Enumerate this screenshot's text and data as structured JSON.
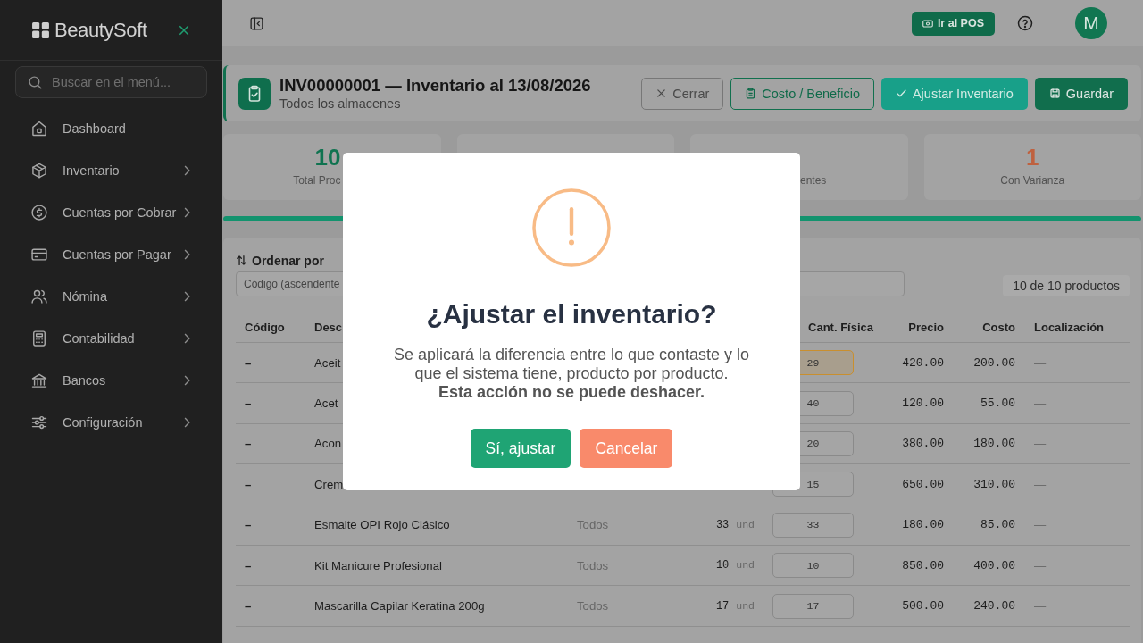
{
  "sidebar": {
    "brand": "BeautySoft",
    "search": {
      "placeholder": "Buscar en el menú..."
    },
    "items": [
      {
        "label": "Dashboard",
        "expandable": false
      },
      {
        "label": "Inventario",
        "expandable": true
      },
      {
        "label": "Cuentas por Cobrar",
        "expandable": true
      },
      {
        "label": "Cuentas por Pagar",
        "expandable": true
      },
      {
        "label": "Nómina",
        "expandable": true
      },
      {
        "label": "Contabilidad",
        "expandable": true
      },
      {
        "label": "Bancos",
        "expandable": true
      },
      {
        "label": "Configuración",
        "expandable": true
      }
    ]
  },
  "topbar": {
    "pos_button": "Ir al POS",
    "avatar": "M"
  },
  "document": {
    "title": "INV00000001 — Inventario al 13/08/2026",
    "subtitle": "Todos los almacenes",
    "actions": [
      {
        "label": "Cerrar",
        "kind": "close"
      },
      {
        "label": "Costo / Beneficio",
        "kind": "report"
      },
      {
        "label": "Ajustar Inventario",
        "kind": "adjust"
      },
      {
        "label": "Guardar",
        "kind": "save"
      }
    ]
  },
  "stats": [
    {
      "value": "10",
      "label": "Total Proc",
      "color": "#0f7350"
    },
    {
      "label": "entes"
    },
    {
      "value": "1",
      "label": "Con Varianza",
      "color": "#bf613f"
    }
  ],
  "progress": {
    "level": 1
  },
  "products": {
    "sort_label": "Ordenar por",
    "sort_value": "Código (ascendente",
    "count": "10 de 10 productos",
    "columns": {
      "code": "Código",
      "description": "Desc",
      "physical_qty": "Cant. Física",
      "price": "Precio",
      "cost": "Costo",
      "location": "Localización"
    },
    "rows": [
      {
        "code": "–",
        "description": "Aceit",
        "physical_qty": "29",
        "price": "420.00",
        "cost": "200.00",
        "location": "—",
        "has_variance": true
      },
      {
        "code": "–",
        "description": "Acet",
        "physical_qty": "40",
        "price": "120.00",
        "cost": "55.00",
        "location": "—",
        "has_variance": false
      },
      {
        "code": "–",
        "description": "Acon",
        "physical_qty": "20",
        "price": "380.00",
        "cost": "180.00",
        "location": "—",
        "has_variance": false
      },
      {
        "code": "–",
        "description": "Crem",
        "physical_qty": "15",
        "price": "650.00",
        "cost": "310.00",
        "location": "—",
        "has_variance": false
      },
      {
        "code": "–",
        "description": "Esmalte OPI Rojo Clásico",
        "warehouse": "Todos",
        "system_qty": "33",
        "unit": "und",
        "physical_qty": "33",
        "price": "180.00",
        "cost": "85.00",
        "location": "—",
        "has_variance": false
      },
      {
        "code": "–",
        "description": "Kit Manicure Profesional",
        "warehouse": "Todos",
        "system_qty": "10",
        "unit": "und",
        "physical_qty": "10",
        "price": "850.00",
        "cost": "400.00",
        "location": "—",
        "has_variance": false
      },
      {
        "code": "–",
        "description": "Mascarilla Capilar Keratina 200g",
        "warehouse": "Todos",
        "system_qty": "17",
        "unit": "und",
        "physical_qty": "17",
        "price": "500.00",
        "cost": "240.00",
        "location": "—",
        "has_variance": false
      }
    ]
  },
  "dialog": {
    "title": "¿Ajustar el inventario?",
    "message": "Se aplicará la diferencia entre lo que contaste y lo que el sistema tiene, producto por producto. **Esta acción no se puede deshacer.**",
    "buttons": [
      {
        "label": "Sí, ajustar",
        "kind": "confirm"
      },
      {
        "label": "Cancelar",
        "kind": "cancel"
      }
    ]
  }
}
